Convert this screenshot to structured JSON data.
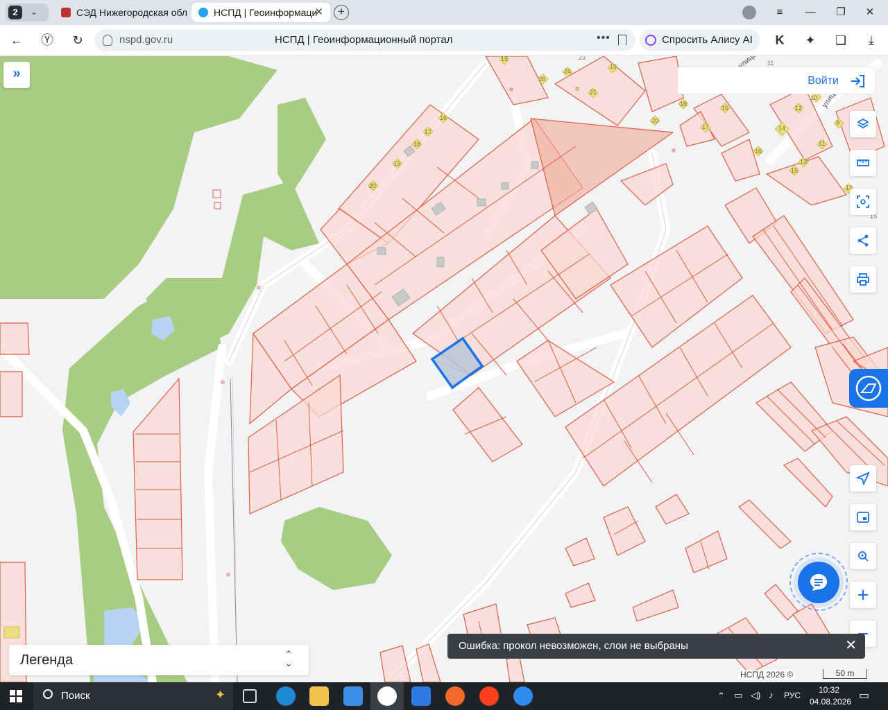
{
  "browser": {
    "tab_count": "2",
    "tabs": [
      {
        "title": "СЭД Нижегородская обл"
      },
      {
        "title": "НСПД | Геоинформаци"
      }
    ],
    "url": "nspd.gov.ru",
    "page_title": "НСПД | Геоинформационный портал",
    "alice_label": "Спросить Алису AI"
  },
  "map": {
    "login_label": "Войти",
    "legend_label": "Легенда",
    "toast_message": "Ошибка: прокол невозможен, слои не выбраны",
    "copyright": "НСПД 2026 ©",
    "scale_label": "50 m",
    "street_labels": [
      "улица",
      "улица"
    ],
    "house_numbers": [
      "15",
      "23",
      "19",
      "24",
      "26",
      "21",
      "20",
      "18",
      "17",
      "16",
      "18",
      "19",
      "20",
      "15",
      "12",
      "14",
      "11",
      "9",
      "16",
      "13",
      "15",
      "17",
      "11",
      "12",
      "10",
      "15"
    ]
  },
  "taskbar": {
    "search_label": "Поиск",
    "language": "РУС",
    "time": "10:32",
    "date": "04.08.2026"
  },
  "colors": {
    "accent": "#1a73e8",
    "parcel_fill": "#f8d8d2",
    "parcel_stroke": "#e55b45",
    "vegetation": "#a8cc82",
    "water": "#b7d4f4",
    "selected_parcel": "#1a73e8"
  }
}
